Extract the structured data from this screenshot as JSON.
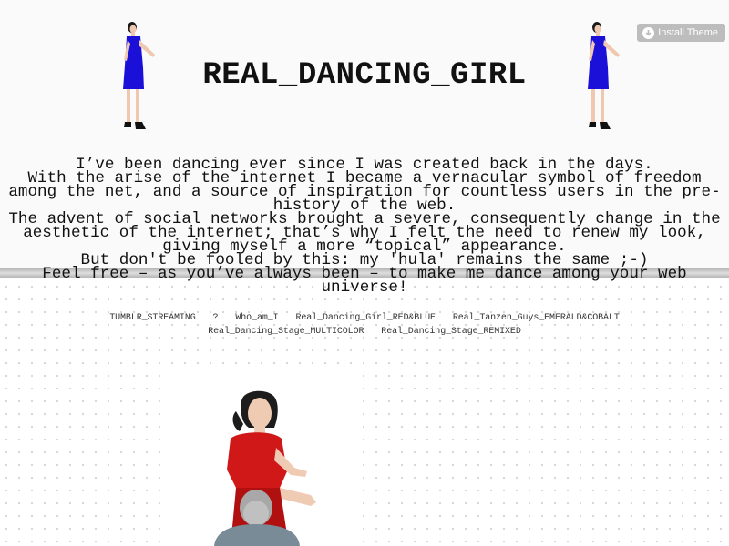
{
  "header": {
    "title": "REAL_DANCING_GIRL",
    "install_label": "Install Theme",
    "icons": {
      "install": "download-icon"
    }
  },
  "intro": {
    "paragraphs": [
      "I’ve been dancing ever since I was created back in the days.",
      "With the arise of the internet I became a vernacular symbol of freedom among the net, and a source of inspiration for countless users in the pre-history of the web.",
      "The advent of social networks brought a severe, consequently change in the aesthetic of the internet; that’s why I felt the need to renew my look, giving myself a more “topical” appearance.",
      "But don't be fooled by this: my 'hula' remains the same ;-)",
      "Feel free – as you’ve always been – to make me dance among your web universe!"
    ]
  },
  "nav": {
    "links": [
      "TUMBLR_STREAMING",
      "?",
      "Who_am_I",
      "Real_Dancing_Girl_RED&BLUE",
      "Real_Tanzen_Guys_EMERALD&COBALT",
      "Real_Dancing_Stage_MULTICOLOR",
      "Real_Dancing_Stage_REMIXED"
    ]
  },
  "colors": {
    "dress_blue": "#1a10d8",
    "dress_red": "#d01818",
    "button_gray": "#bdbdbd",
    "stripe_gray": "#c4c4c4"
  }
}
